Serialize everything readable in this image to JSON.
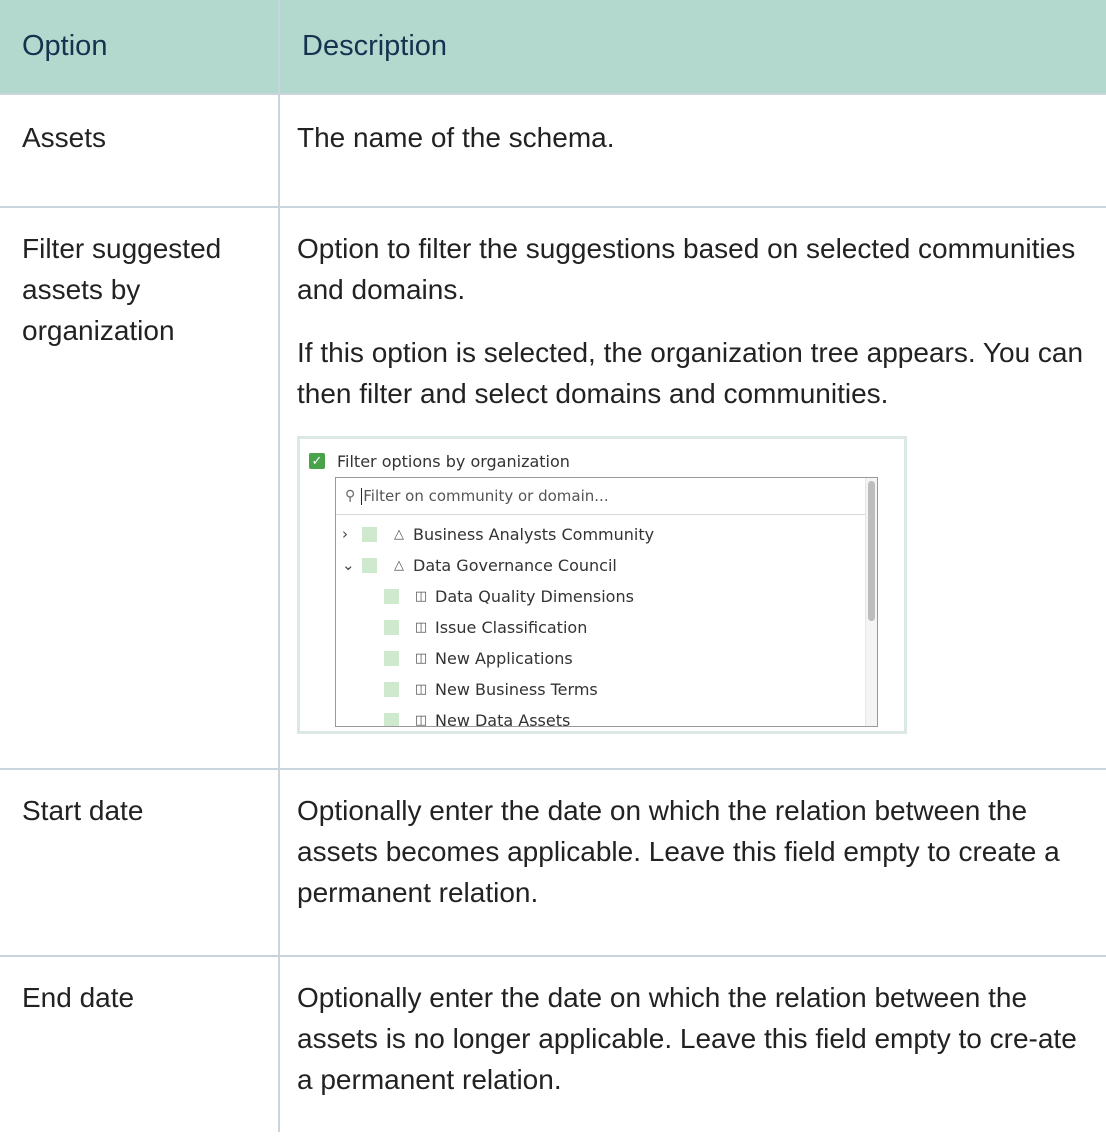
{
  "table": {
    "header": {
      "option": "Option",
      "description": "Description"
    },
    "rows": [
      {
        "option": "Assets",
        "description": [
          "The name of the schema."
        ]
      },
      {
        "option": "Filter suggested assets by organization",
        "description": [
          "Option to filter the suggestions based on selected communities and domains.",
          "If this option is selected, the organization tree appears. You can then filter and select domains and communities."
        ]
      },
      {
        "option": "Start date",
        "description": [
          "Optionally enter the date on which the relation between the assets becomes applicable. Leave this field empty to create a permanent relation."
        ]
      },
      {
        "option": "End date",
        "description": [
          "Optionally enter the date on which the relation between the assets is no longer applicable. Leave this field empty to cre-ate a permanent relation."
        ]
      }
    ]
  },
  "widget": {
    "checkbox_label": "Filter options by organization",
    "checkbox_checked": true,
    "search_placeholder": "Filter on community or domain...",
    "tree": [
      {
        "label": "Business Analysts Community",
        "type": "community",
        "expanded": false
      },
      {
        "label": "Data Governance Council",
        "type": "community",
        "expanded": true
      },
      {
        "label": "Data Quality Dimensions",
        "type": "domain"
      },
      {
        "label": "Issue Classification",
        "type": "domain"
      },
      {
        "label": "New Applications",
        "type": "domain"
      },
      {
        "label": "New Business Terms",
        "type": "domain"
      },
      {
        "label": "New Data Assets",
        "type": "domain"
      }
    ],
    "colors": {
      "check": "#48a34a",
      "node_box": "#cfe9cf",
      "header_bg": "#b3d9cf"
    },
    "icons": {
      "search": "search-icon",
      "expanded": "chevron-down-icon",
      "collapsed": "chevron-right-icon",
      "community": "community-icon",
      "domain": "domain-icon"
    }
  }
}
